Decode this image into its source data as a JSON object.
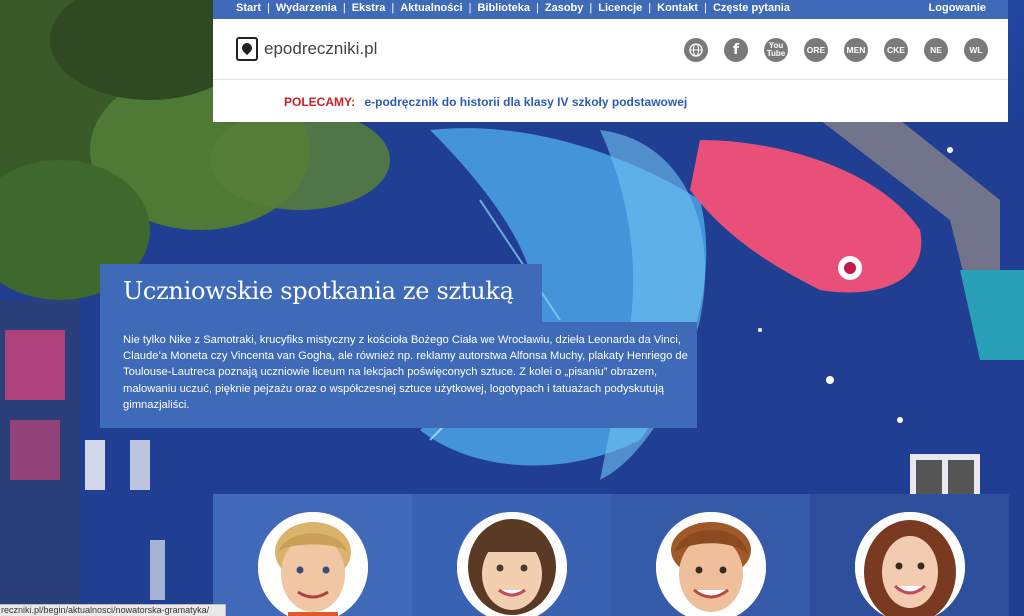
{
  "nav": {
    "items": [
      "Start",
      "Wydarzenia",
      "Ekstra",
      "Aktualności",
      "Biblioteka",
      "Zasoby",
      "Licencje",
      "Kontakt",
      "Częste pytania"
    ],
    "login": "Logowanie"
  },
  "header": {
    "logo_text": "epodreczniki.pl",
    "icons": [
      {
        "name": "globe-icon",
        "label": ""
      },
      {
        "name": "facebook-icon",
        "label": "f"
      },
      {
        "name": "youtube-icon",
        "label": "You Tube"
      },
      {
        "name": "ore-icon",
        "label": "ORE"
      },
      {
        "name": "men-icon",
        "label": "MEN"
      },
      {
        "name": "cke-icon",
        "label": "CKE"
      },
      {
        "name": "ne-icon",
        "label": "NE"
      },
      {
        "name": "wl-icon",
        "label": "WL"
      }
    ],
    "recommend_label": "POLECAMY:",
    "recommend_link": "e-podręcznik do historii dla klasy IV szkoły podstawowej"
  },
  "feature": {
    "title": "Uczniowskie spotkania ze sztuką",
    "text": "Nie tylko Nike z Samotraki, krucyfiks mistyczny z kościoła Bożego Ciała we Wrocławiu, dzieła Leonarda da Vinci, Claude’a Moneta czy Vincenta van Gogha, ale również np. reklamy autorstwa Alfonsa Muchy, plakaty Henriego de Toulouse-Lautreca poznają uczniowie liceum na lekcjach poświęconych sztuce. Z kolei o „pisaniu” obrazem, malowaniu uczuć, pięknie pejzażu oraz o współczesnej sztuce użytkowej, logotypach i tatuażach podyskutują gimnazjaliści."
  },
  "status_url": "reczniki.pl/begin/aktualnosci/nowatorska-gramatyka/",
  "colors": {
    "nav_blue": "#3e6ab8",
    "polecamy_red": "#c8202a",
    "link_blue": "#2d5cb3",
    "tile_colors": [
      "#4069b8",
      "#3a62b2",
      "#345aa8",
      "#2d4f9c"
    ]
  }
}
